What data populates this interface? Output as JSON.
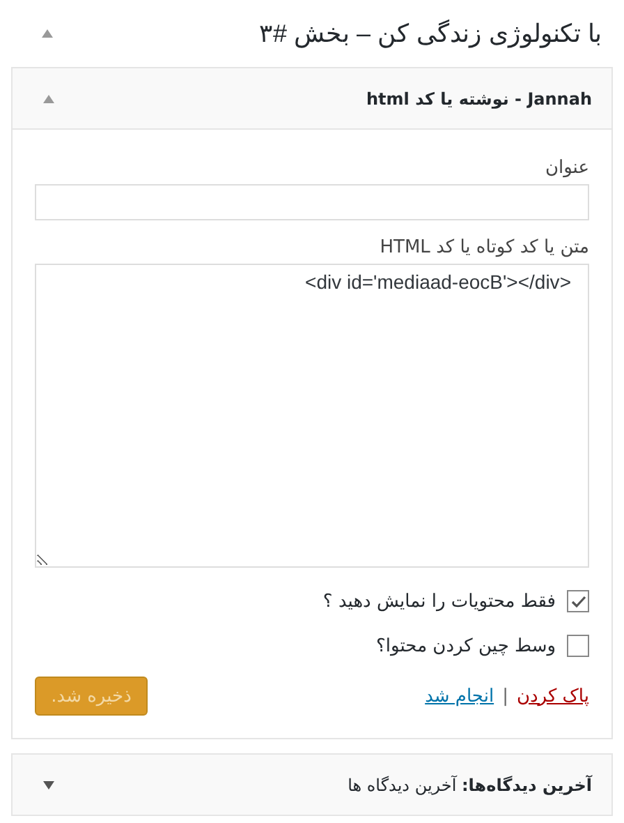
{
  "section": {
    "title": "با تکنولوژی زندگی کن – بخش #۳",
    "expanded": true
  },
  "widgets": [
    {
      "title": "Jannah - نوشته یا کد html",
      "expanded": true,
      "form": {
        "fields": [
          {
            "kind": "input",
            "label": "عنوان"
          },
          {
            "kind": "textarea",
            "label": "متن یا کد کوتاه یا کد HTML",
            "value": "<div id='mediaad-eocB'></div>"
          }
        ],
        "options": [
          {
            "label": "فقط محتویات را نمایش دهید ؟",
            "checked": true
          },
          {
            "label": "وسط چین کردن محتوا؟",
            "checked": false
          }
        ],
        "delete_link": "پاک کردن",
        "separator": "|",
        "done_link": "انجام شد",
        "save_button": {
          "label": "ذخیره شد.",
          "disabled": true
        }
      }
    },
    {
      "title": "**آخرین دیدگاه‌ها:** آخرین دیدگاه ها",
      "expanded": false
    }
  ]
}
